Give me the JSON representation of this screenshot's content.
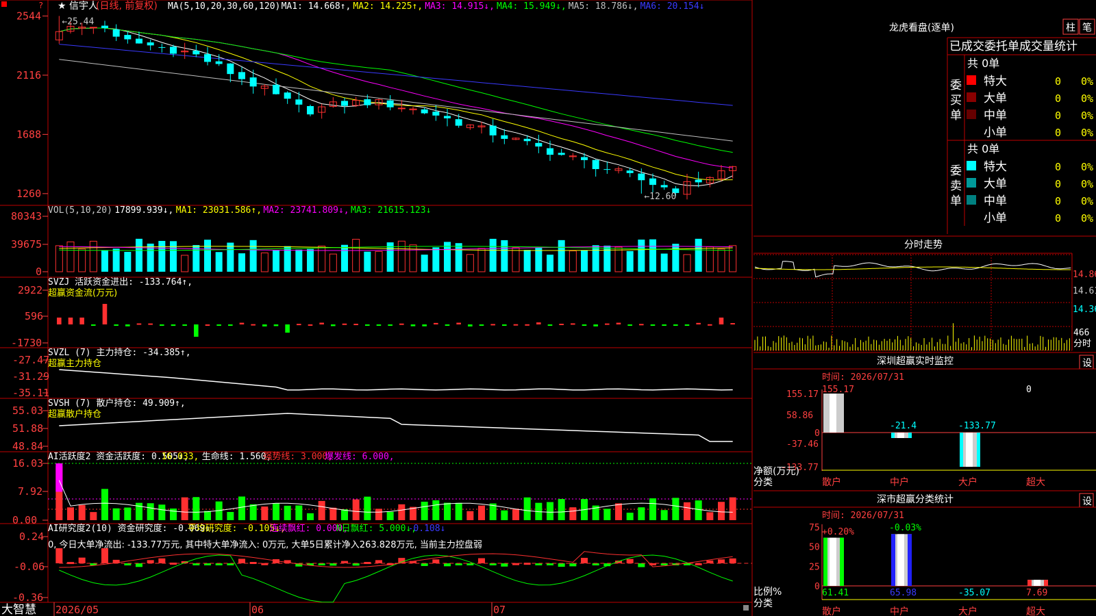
{
  "colors": {
    "up": "#ff3030",
    "down": "#00ffff",
    "grid": "#c00000",
    "axis": "#ff4040",
    "white": "#ffffff",
    "yellow": "#ffff00",
    "magenta": "#ff00ff",
    "green": "#00ff00",
    "blue": "#3a3aff",
    "gray": "#c0c0c0"
  },
  "stock": {
    "star": "★",
    "name": "信宇人",
    "period": "(日线, 前复权)",
    "hi_label": "←25.44",
    "lo_label": "←12.60"
  },
  "price_panel": {
    "axis": [
      "2544",
      "2116",
      "1688",
      "1260"
    ],
    "legend": [
      {
        "text": "MA(5,10,20,30,60,120)",
        "color": "#ffffff"
      },
      {
        "text": "MA1: 14.668↑,",
        "color": "#ffffff"
      },
      {
        "text": "MA2: 14.225↑,",
        "color": "#ffff00"
      },
      {
        "text": "MA3: 14.915↓,",
        "color": "#ff00ff"
      },
      {
        "text": "MA4: 15.949↓,",
        "color": "#00ff00"
      },
      {
        "text": "MA5: 18.786↓,",
        "color": "#c0c0c0"
      },
      {
        "text": "MA6: 20.154↓",
        "color": "#3a3aff"
      }
    ]
  },
  "vol_panel": {
    "axis": [
      "80343",
      "39675",
      "0"
    ],
    "legend": [
      {
        "text": "VOL(5,10,20)",
        "color": "#c8c8c8"
      },
      {
        "text": "17899.939↓,",
        "color": "#ffffff"
      },
      {
        "text": "MA1: 23031.586↑,",
        "color": "#ffff00"
      },
      {
        "text": "MA2: 23741.809↓,",
        "color": "#ff00ff"
      },
      {
        "text": "MA3: 21615.123↓",
        "color": "#00ff00"
      }
    ]
  },
  "svzj_panel": {
    "axis": [
      "2922",
      "596",
      "-1730"
    ],
    "legend": [
      {
        "text": "SVZJ  活跃资金进出: -133.764↑,",
        "color": "#ffffff"
      }
    ],
    "sub": "超赢资金流(万元)"
  },
  "svzl_panel": {
    "axis": [
      "-27.47",
      "-31.29",
      "-35.11"
    ],
    "legend": [
      {
        "text": "SVZL (7) 主力持仓: -34.385↑,",
        "color": "#ffffff"
      }
    ],
    "sub": "超赢主力持仓"
  },
  "svsh_panel": {
    "axis": [
      "55.03",
      "51.88",
      "48.84"
    ],
    "legend": [
      {
        "text": "SVSH (7) 散户持仓: 49.909↑,",
        "color": "#ffffff"
      }
    ],
    "sub": "超赢散户持仓"
  },
  "ai_panel": {
    "axis": [
      "16.03",
      "7.92",
      "0.00"
    ],
    "legend": [
      {
        "text": "AI活跃度2 资金活跃度: 0.505↓,",
        "color": "#ffffff"
      },
      {
        "text": "16.033,",
        "color": "#ffff00"
      },
      {
        "text": "生命线: 1.560,",
        "color": "#ffffff"
      },
      {
        "text": "强势线: 3.000,",
        "color": "#ff3030"
      },
      {
        "text": "爆发线: 6.000,",
        "color": "#ff00ff"
      }
    ]
  },
  "research_panel": {
    "axis": [
      "0.24",
      "-0.06",
      "-0.36"
    ],
    "legend": [
      {
        "text": "AI研究度2(10) 资金研究度: -0.069↓,",
        "color": "#ffffff"
      },
      {
        "text": "平均研究度: -0.105↓,",
        "color": "#ffff00"
      },
      {
        "text": "连续飘红: 0.000,",
        "color": "#ff00ff"
      },
      {
        "text": "N日飘红: 5.000↓,",
        "color": "#00ff00"
      },
      {
        "text": "-0.108↓",
        "color": "#3a3aff"
      }
    ],
    "note": "0, 今日大单净流出: -133.77万元, 其中特大单净流入: 0万元, 大单5日累计净入263.828万元, 当前主力控盘弱"
  },
  "date_axis": [
    "2026/05",
    "06",
    "07"
  ],
  "brand": "大智慧",
  "right": {
    "dragon_title": "龙虎看盘(逐单)",
    "btn_zhu": "柱",
    "btn_bi": "笔",
    "stats_title": "已成交委托单成交量统计",
    "buy": {
      "side": "委买单",
      "total": "共 0单",
      "rows": [
        {
          "label": "特大",
          "vol": "0",
          "pct": "0%",
          "color": "#ff0000"
        },
        {
          "label": "大单",
          "vol": "0",
          "pct": "0%",
          "color": "#880000"
        },
        {
          "label": "中单",
          "vol": "0",
          "pct": "0%",
          "color": "#660000"
        },
        {
          "label": "小单",
          "vol": "0",
          "pct": "0%",
          "color": "#000000"
        }
      ]
    },
    "sell": {
      "side": "委卖单",
      "total": "共 0单",
      "rows": [
        {
          "label": "特大",
          "vol": "0",
          "pct": "0%",
          "color": "#00ffff"
        },
        {
          "label": "大单",
          "vol": "0",
          "pct": "0%",
          "color": "#009999"
        },
        {
          "label": "中单",
          "vol": "0",
          "pct": "0%",
          "color": "#008080"
        },
        {
          "label": "小单",
          "vol": "0",
          "pct": "0%",
          "color": "#000000"
        }
      ]
    },
    "intraday_title": "分时走势",
    "intraday_axis": [
      "14.86",
      "14.61",
      "14.36"
    ],
    "intraday_vol": "466",
    "intraday_time": "分时",
    "monitor": {
      "title": "深圳超赢实时监控",
      "settings": "设",
      "time": "时间: 2026/07/31",
      "axis": [
        "155.17",
        "58.86",
        "0",
        "-37.46",
        "-133.77"
      ],
      "labels": [
        "散户",
        "中户",
        "大户",
        "超大"
      ],
      "values": [
        155.17,
        -21.4,
        -133.77,
        0
      ],
      "value_text": [
        "155.17",
        "-21.4",
        "-133.77",
        "0"
      ],
      "ylabel": "净额(万元)",
      "xlabel": "分类"
    },
    "classify": {
      "title": "深市超赢分类统计",
      "settings": "设",
      "time": "时间: 2026/07/31",
      "axis": [
        "75",
        "50",
        "25",
        "0"
      ],
      "labels": [
        "散户",
        "中户",
        "大户",
        "超大"
      ],
      "values": [
        61.41,
        65.98,
        -35.07,
        7.69
      ],
      "value_text": [
        "61.41",
        "65.98",
        "-35.07",
        "7.69"
      ],
      "top_text": [
        "+0.20%",
        "-0.03%"
      ],
      "ylabel": "比例%",
      "xlabel": "分类"
    }
  }
}
